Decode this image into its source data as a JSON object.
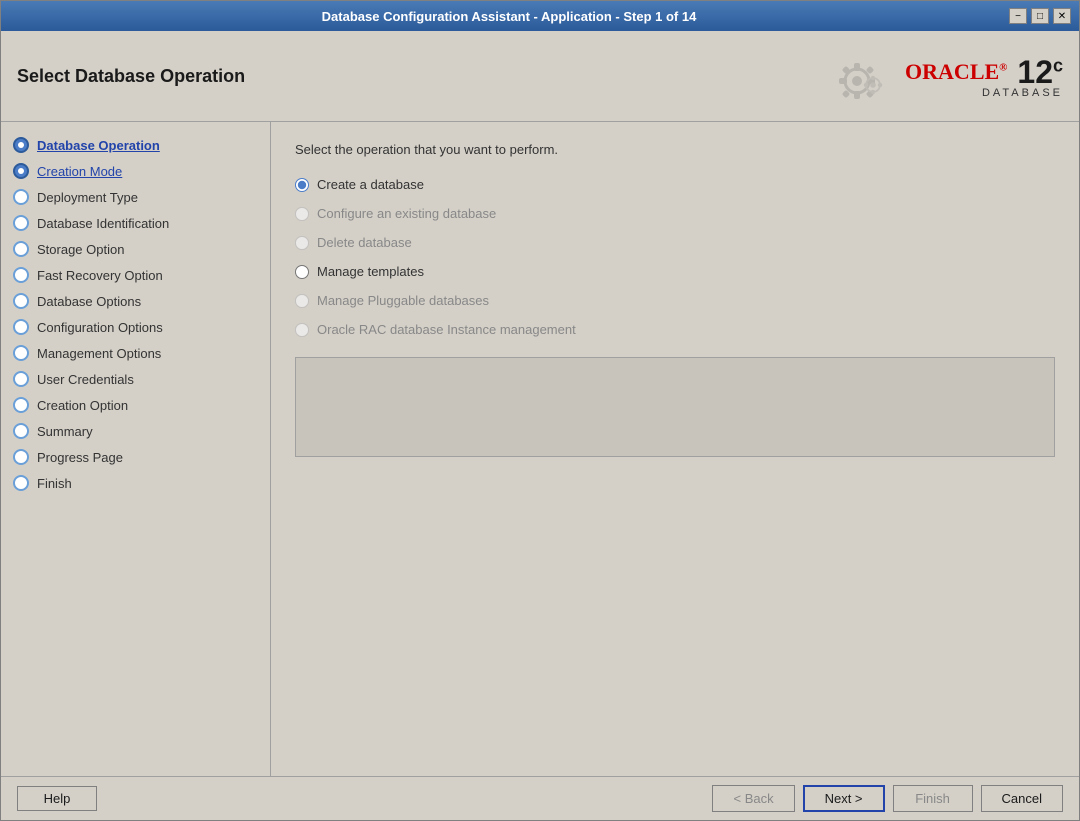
{
  "window": {
    "title": "Database Configuration Assistant - Application - Step 1 of 14",
    "minimize_label": "−",
    "restore_label": "□",
    "close_label": "✕"
  },
  "header": {
    "title": "Select Database Operation",
    "oracle_brand": "ORACLE",
    "oracle_reg": "®",
    "oracle_12": "12",
    "oracle_c": "c",
    "oracle_database": "DATABASE"
  },
  "sidebar": {
    "items": [
      {
        "id": "database-operation",
        "label": "Database Operation",
        "state": "active",
        "dot": "filled"
      },
      {
        "id": "creation-mode",
        "label": "Creation Mode",
        "state": "link",
        "dot": "filled"
      },
      {
        "id": "deployment-type",
        "label": "Deployment Type",
        "state": "normal",
        "dot": "empty"
      },
      {
        "id": "database-identification",
        "label": "Database Identification",
        "state": "normal",
        "dot": "empty"
      },
      {
        "id": "storage-option",
        "label": "Storage Option",
        "state": "normal",
        "dot": "empty"
      },
      {
        "id": "fast-recovery-option",
        "label": "Fast Recovery Option",
        "state": "normal",
        "dot": "empty"
      },
      {
        "id": "database-options",
        "label": "Database Options",
        "state": "normal",
        "dot": "empty"
      },
      {
        "id": "configuration-options",
        "label": "Configuration Options",
        "state": "normal",
        "dot": "empty"
      },
      {
        "id": "management-options",
        "label": "Management Options",
        "state": "normal",
        "dot": "empty"
      },
      {
        "id": "user-credentials",
        "label": "User Credentials",
        "state": "normal",
        "dot": "empty"
      },
      {
        "id": "creation-option",
        "label": "Creation Option",
        "state": "normal",
        "dot": "empty"
      },
      {
        "id": "summary",
        "label": "Summary",
        "state": "normal",
        "dot": "empty"
      },
      {
        "id": "progress-page",
        "label": "Progress Page",
        "state": "normal",
        "dot": "empty"
      },
      {
        "id": "finish",
        "label": "Finish",
        "state": "normal",
        "dot": "empty"
      }
    ]
  },
  "main": {
    "instruction": "Select the operation that you want to perform.",
    "radio_options": [
      {
        "id": "create-db",
        "label": "Create a database",
        "checked": true,
        "enabled": true
      },
      {
        "id": "configure-existing",
        "label": "Configure an existing database",
        "checked": false,
        "enabled": false
      },
      {
        "id": "delete-db",
        "label": "Delete database",
        "checked": false,
        "enabled": false
      },
      {
        "id": "manage-templates",
        "label": "Manage templates",
        "checked": false,
        "enabled": true
      },
      {
        "id": "manage-pluggable",
        "label": "Manage Pluggable databases",
        "checked": false,
        "enabled": false
      },
      {
        "id": "oracle-rac",
        "label": "Oracle RAC database Instance management",
        "checked": false,
        "enabled": false
      }
    ]
  },
  "buttons": {
    "help": "Help",
    "back": "< Back",
    "next": "Next >",
    "finish": "Finish",
    "cancel": "Cancel"
  }
}
